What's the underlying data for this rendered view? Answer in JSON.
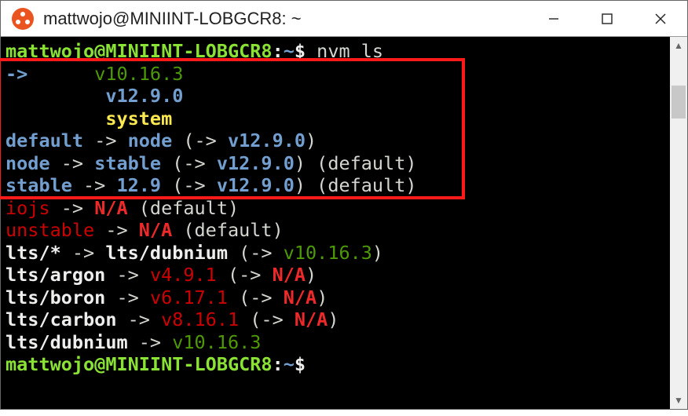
{
  "window": {
    "title": "mattwojo@MINIINT-LOBGCR8: ~"
  },
  "prompt": {
    "userhost": "mattwojo@MINIINT-LOBGCR8",
    "sep": ":",
    "path": "~",
    "dollar": "$"
  },
  "command": " nvm ls",
  "lines": {
    "l2a": "->      ",
    "l2b": "v10.16.3",
    "l3pad": "         ",
    "l3": "v12.9.0",
    "l4pad": "         ",
    "l4": "system",
    "l5a": "default",
    "arrow": " -> ",
    "l5b": "node",
    "open": " (",
    "innerArrow": "-> ",
    "l5c": "v12.9.0",
    "close": ")",
    "l6a": "node",
    "l6b": "stable",
    "l6c": "v12.9.0",
    "deflabel": " (default)",
    "l7a": "stable",
    "l7b": "12.9",
    "l7c": "v12.9.0",
    "l8a": "iojs",
    "l8b": "N/A",
    "l9a": "unstable",
    "l9b": "N/A",
    "l10a": "lts/*",
    "l10b": "lts/dubnium",
    "l10c": "v10.16.3",
    "l11a": "lts/argon",
    "l11b": "v4.9.1",
    "l11c": "N/A",
    "l12a": "lts/boron",
    "l12b": "v6.17.1",
    "l12c": "N/A",
    "l13a": "lts/carbon",
    "l13b": "v8.16.1",
    "l13c": "N/A",
    "l14a": "lts/dubnium",
    "l14b": "v10.16.3"
  }
}
